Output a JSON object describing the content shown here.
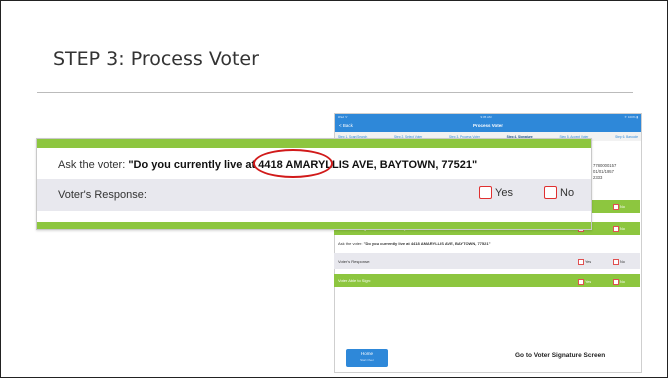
{
  "slide": {
    "title": "STEP 3: Process Voter"
  },
  "ipad": {
    "status_left": "iPad ᯤ",
    "status_time": "9:05 AM",
    "status_right": "✈ 100% ▮",
    "nav_back": "< Back",
    "nav_title": "Process Voter",
    "steps": [
      "Step 1. Scan/Search",
      "Step 2. Select Voter",
      "Step 3. Process Voter",
      "Step 4. Signature",
      "Step 5. Accept Voter",
      "Step 6. Barcode"
    ],
    "active_step_index": 3,
    "side_info": [
      "7780000157",
      "01/01/1957",
      "2333"
    ],
    "top_green_opts": {
      "no": "No"
    },
    "reg_name_question": "Does Voter Registration Name Exactly Match Photo ID?",
    "reg_name_yes": "Yes",
    "reg_name_no": "No",
    "ask_prefix": "Ask the voter:",
    "ask_question": "\"Do you currently live at 4418 AMARYLLIS AVE, BAYTOWN, 77521\"",
    "voter_response_label": "Voter's Response:",
    "resp_yes": "Yes",
    "resp_no": "No",
    "able_to_sign": "Voter Able to Sign:",
    "sign_yes": "Yes",
    "sign_no": "No",
    "home_label": "Home",
    "home_sub": "Start Over",
    "signature_button": "Go to Voter Signature Screen"
  },
  "callout": {
    "ask_prefix": "Ask the voter:",
    "question_part1": "\"Do you currently live at 4418 ",
    "question_highlight": "AMARYLLIS AVE",
    "question_part2": ", BAYTOWN, 77521\"",
    "response_label": "Voter's Response:",
    "yes_label": "Yes",
    "no_label": "No"
  },
  "colors": {
    "accent_blue": "#2e88d9",
    "green_bar": "#8dc63f",
    "highlight_red": "#d11a1a"
  }
}
